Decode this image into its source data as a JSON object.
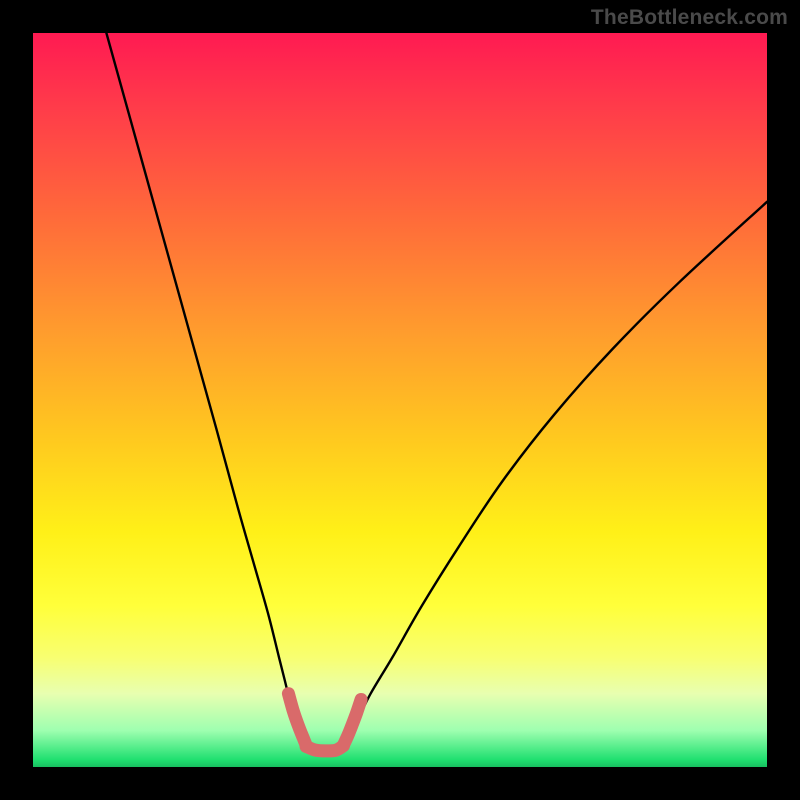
{
  "watermark": "TheBottleneck.com",
  "chart_data": {
    "type": "line",
    "title": "",
    "xlabel": "",
    "ylabel": "",
    "xlim": [
      0,
      100
    ],
    "ylim": [
      0,
      100
    ],
    "grid": false,
    "legend": false,
    "background_gradient": {
      "top": "#ff1a52",
      "mid_top": "#ff9a2e",
      "mid": "#fff018",
      "mid_bottom": "#f8ff70",
      "bottom": "#20e070"
    },
    "series": [
      {
        "name": "left-falling-curve",
        "color": "#000000",
        "x": [
          10,
          15,
          20,
          25,
          28,
          30,
          32,
          33.5,
          34.5,
          35.2,
          35.8,
          36.3,
          36.8
        ],
        "values": [
          100,
          82,
          64,
          46,
          35,
          28,
          21,
          15,
          11,
          8,
          6,
          4.5,
          3.5
        ]
      },
      {
        "name": "right-rising-curve",
        "color": "#000000",
        "x": [
          42.5,
          44,
          46,
          49,
          53,
          58,
          64,
          71,
          79,
          88,
          100
        ],
        "values": [
          3.5,
          6,
          10,
          15,
          22,
          30,
          39,
          48,
          57,
          66,
          77
        ]
      },
      {
        "name": "highlight-left-segment",
        "color": "#d96a6a",
        "x": [
          34.8,
          35.5,
          36.2,
          36.8,
          37.2
        ],
        "values": [
          10,
          7.5,
          5.5,
          4,
          3
        ]
      },
      {
        "name": "highlight-bottom-segment",
        "color": "#d96a6a",
        "x": [
          37.2,
          38.5,
          40.0,
          41.3,
          42.3
        ],
        "values": [
          2.8,
          2.3,
          2.2,
          2.3,
          2.9
        ]
      },
      {
        "name": "highlight-right-segment",
        "color": "#d96a6a",
        "x": [
          42.3,
          42.9,
          43.5,
          44.1,
          44.7
        ],
        "values": [
          3.0,
          4.3,
          5.8,
          7.4,
          9.2
        ]
      }
    ]
  }
}
